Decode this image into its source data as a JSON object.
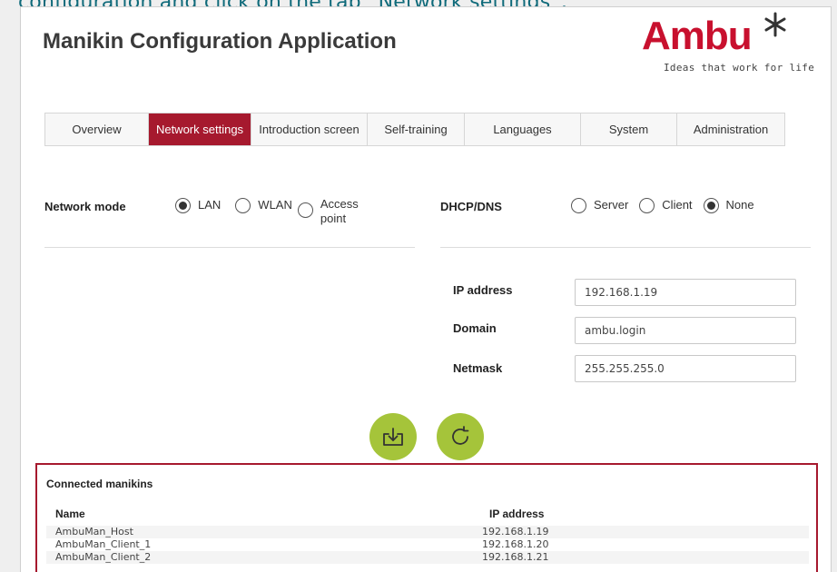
{
  "caption": "configuration and click on the tab “Network settings”.",
  "app": {
    "title": "Manikin Configuration Application",
    "logo": {
      "word": "Ambu",
      "tagline": "Ideas that work for life"
    }
  },
  "tabs": [
    {
      "label": "Overview",
      "active": false
    },
    {
      "label": "Network settings",
      "active": true
    },
    {
      "label": "Introduction screen",
      "active": false
    },
    {
      "label": "Self-training",
      "active": false
    },
    {
      "label": "Languages",
      "active": false
    },
    {
      "label": "System",
      "active": false
    },
    {
      "label": "Administration",
      "active": false
    }
  ],
  "network_mode": {
    "label": "Network mode",
    "options": [
      {
        "label": "LAN",
        "selected": true
      },
      {
        "label": "WLAN",
        "selected": false
      },
      {
        "label": "Access point",
        "selected": false
      }
    ]
  },
  "dhcp": {
    "label": "DHCP/DNS",
    "options": [
      {
        "label": "Server",
        "selected": false
      },
      {
        "label": "Client",
        "selected": false
      },
      {
        "label": "None",
        "selected": true
      }
    ]
  },
  "fields": {
    "ip": {
      "label": "IP address",
      "value": "192.168.1.19"
    },
    "domain": {
      "label": "Domain",
      "value": "ambu.login"
    },
    "netmask": {
      "label": "Netmask",
      "value": "255.255.255.0"
    }
  },
  "buttons": {
    "save_icon": "download-icon",
    "refresh_icon": "refresh-icon"
  },
  "manikins": {
    "title": "Connected manikins",
    "columns": {
      "name": "Name",
      "ip": "IP address"
    },
    "rows": [
      {
        "name": "AmbuMan_Host",
        "ip": "192.168.1.19"
      },
      {
        "name": "AmbuMan_Client_1",
        "ip": "192.168.1.20"
      },
      {
        "name": "AmbuMan_Client_2",
        "ip": "192.168.1.21"
      }
    ]
  },
  "colors": {
    "brand": "#a6192e",
    "logo": "#c8102e",
    "accent_green": "#a5c43a"
  }
}
